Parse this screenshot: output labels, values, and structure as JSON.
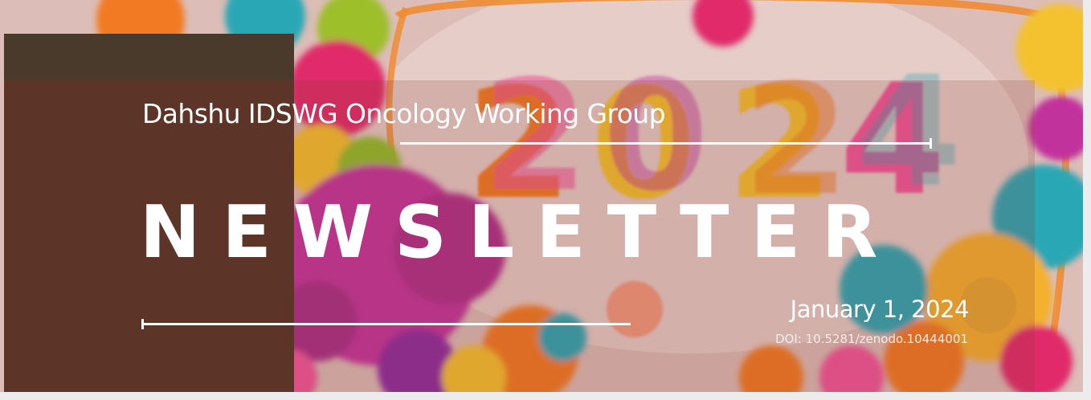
{
  "header": {
    "organization": "Dahshu IDSWG Oncology Working Group",
    "title": "NEWSLETTER",
    "date": "January 1, 2024",
    "doi": "DOI: 10.5281/zenodo.10444001"
  },
  "hero_image": {
    "digits": [
      "2",
      "0",
      "2",
      "4"
    ],
    "palette": {
      "background": "#d9b9b4",
      "magenta": "#c2339d",
      "orange": "#f27a22",
      "yellow": "#f4c22e",
      "teal": "#2aa7b5",
      "green": "#9dbf2c",
      "pink": "#f0559a"
    }
  },
  "colors": {
    "panel_dark": "#5c3528",
    "panel_top": "#4a3a2c",
    "text": "#ffffff"
  }
}
